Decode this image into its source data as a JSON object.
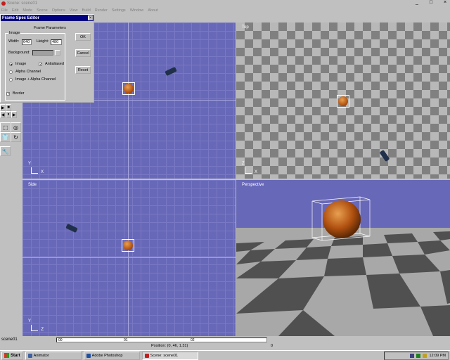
{
  "window": {
    "title": "Scene: scene01",
    "controls": [
      "_",
      "□",
      "×"
    ]
  },
  "menu": [
    "File",
    "Edit",
    "Mode",
    "Scene",
    "Options",
    "View",
    "Build",
    "Render",
    "Settings",
    "Window",
    "About"
  ],
  "viewports": {
    "top": "Top",
    "side": "Side",
    "perspective": "Perspective"
  },
  "axes": {
    "front": [
      "Y",
      "X"
    ],
    "top": [
      "Z",
      "X"
    ],
    "side": [
      "Y",
      "Z"
    ]
  },
  "dialog": {
    "title": "Frame Spec Editor",
    "group_label": "Frame Parameters",
    "image_group": "Image",
    "width_label": "Width:",
    "width_value": "640",
    "height_label": "Height:",
    "height_value": "480",
    "background_label": "Background:",
    "radio_image": "Image",
    "radio_alpha": "Alpha Channel",
    "radio_both": "Image + Alpha Channel",
    "antialiased": "Antialiased",
    "border": "Border",
    "ok": "OK",
    "cancel": "Cancel",
    "reset": "Reset",
    "close": "×"
  },
  "status": {
    "scene": "scene01",
    "ruler": [
      "00",
      "01",
      "02"
    ],
    "position": "Position: (0, 46, 1.31)",
    "frame": "0"
  },
  "taskbar": {
    "start": "Start",
    "tasks": [
      "Animator",
      "Adobe Photoshop",
      "Scene: scene01"
    ],
    "clock": "12:09 PM"
  },
  "tools": [
    "▶",
    "■",
    "◀",
    "⏸",
    "▶",
    "⬚",
    "◎",
    "👕",
    "↻",
    "🔧"
  ]
}
